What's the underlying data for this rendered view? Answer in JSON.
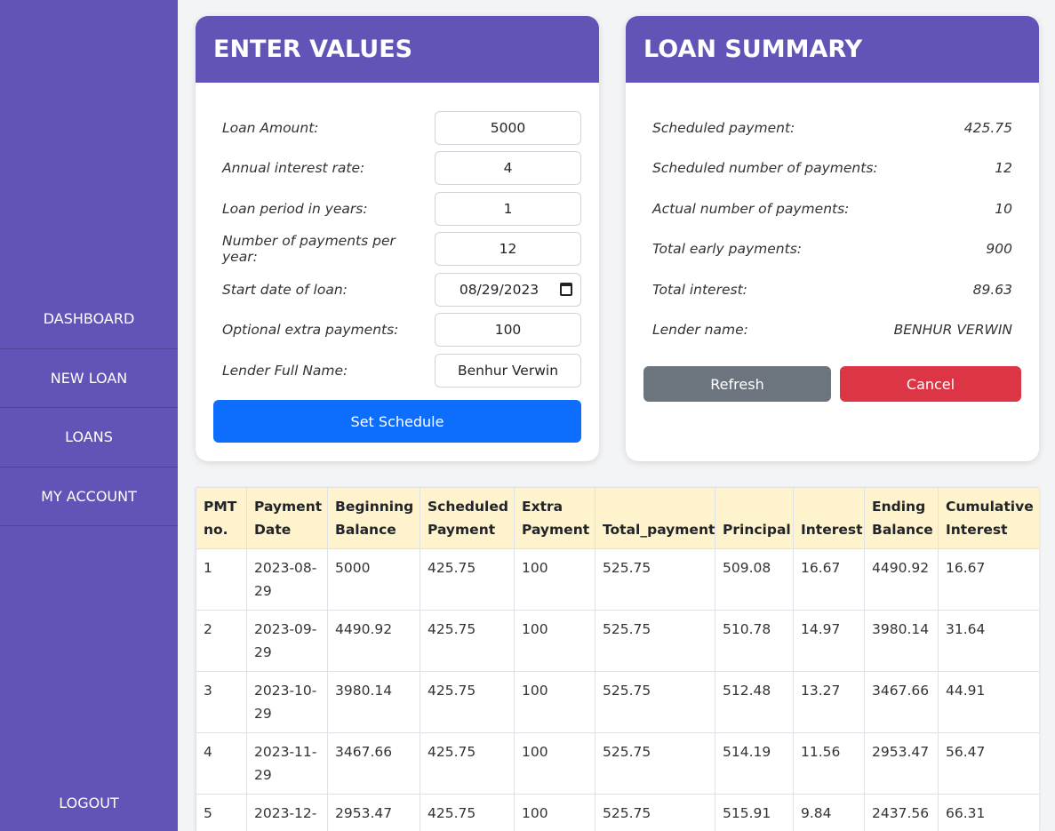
{
  "sidebar": {
    "items": [
      {
        "label": "DASHBOARD"
      },
      {
        "label": "NEW LOAN"
      },
      {
        "label": "LOANS"
      },
      {
        "label": "MY ACCOUNT"
      }
    ],
    "logout": "LOGOUT"
  },
  "values_card": {
    "title": "ENTER VALUES",
    "fields": [
      {
        "label": "Loan Amount:",
        "value": "5000"
      },
      {
        "label": "Annual interest rate:",
        "value": "4"
      },
      {
        "label": "Loan period in years:",
        "value": "1"
      },
      {
        "label": "Number of payments per year:",
        "value": "12"
      },
      {
        "label": "Start date of loan:",
        "value": "08/29/2023"
      },
      {
        "label": "Optional extra payments:",
        "value": "100"
      },
      {
        "label": "Lender Full Name:",
        "value": "Benhur Verwin"
      }
    ],
    "submit_label": "Set Schedule"
  },
  "summary_card": {
    "title": "LOAN SUMMARY",
    "rows": [
      {
        "label": "Scheduled payment:",
        "value": "425.75"
      },
      {
        "label": "Scheduled number of payments:",
        "value": "12"
      },
      {
        "label": "Actual number of payments:",
        "value": "10"
      },
      {
        "label": "Total early payments:",
        "value": "900"
      },
      {
        "label": "Total interest:",
        "value": "89.63"
      },
      {
        "label": "Lender name:",
        "value": "BENHUR VERWIN"
      }
    ],
    "refresh_label": "Refresh",
    "cancel_label": "Cancel"
  },
  "schedule": {
    "headers": [
      "PMT no.",
      "Payment Date",
      "Beginning Balance",
      "Scheduled Payment",
      "Extra Payment",
      "Total_payment",
      "Principal",
      "Interest",
      "Ending Balance",
      "Cumulative Interest"
    ],
    "rows": [
      [
        "1",
        "2023-08-29",
        "5000",
        "425.75",
        "100",
        "525.75",
        "509.08",
        "16.67",
        "4490.92",
        "16.67"
      ],
      [
        "2",
        "2023-09-29",
        "4490.92",
        "425.75",
        "100",
        "525.75",
        "510.78",
        "14.97",
        "3980.14",
        "31.64"
      ],
      [
        "3",
        "2023-10-29",
        "3980.14",
        "425.75",
        "100",
        "525.75",
        "512.48",
        "13.27",
        "3467.66",
        "44.91"
      ],
      [
        "4",
        "2023-11-29",
        "3467.66",
        "425.75",
        "100",
        "525.75",
        "514.19",
        "11.56",
        "2953.47",
        "56.47"
      ],
      [
        "5",
        "2023-12-",
        "2953.47",
        "425.75",
        "100",
        "525.75",
        "515.91",
        "9.84",
        "2437.56",
        "66.31"
      ]
    ]
  }
}
